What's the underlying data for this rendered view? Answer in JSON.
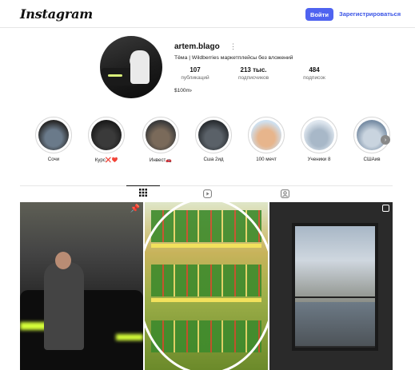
{
  "topbar": {
    "logo": "Instagram",
    "login_label": "Войти",
    "signup_label": "Зарегистрироваться",
    "accent_color": "#4f63f0"
  },
  "profile": {
    "username": "artem.blago",
    "bio": "Тёма | Wildberries маркетплейсы без вложений",
    "income": "$100m›",
    "stats": [
      {
        "value": "107",
        "label": "публикаций"
      },
      {
        "value": "213 тыс.",
        "label": "подписчиков"
      },
      {
        "value": "484",
        "label": "подписок"
      }
    ]
  },
  "highlights": [
    {
      "label": "Сочи",
      "colors": [
        "#2a2a2a",
        "#6a7a8a"
      ]
    },
    {
      "label": "Курс❌❤️",
      "colors": [
        "#1c1c1c",
        "#3a3a3a"
      ]
    },
    {
      "label": "Инвест🚗",
      "colors": [
        "#3b3b3b",
        "#7a6a5a"
      ]
    },
    {
      "label": "Сша 2ид",
      "colors": [
        "#2b2f33",
        "#5a6168"
      ]
    },
    {
      "label": "100 мечт",
      "colors": [
        "#cfe0ef",
        "#e7b58c"
      ]
    },
    {
      "label": "Ученики 8",
      "colors": [
        "#dfe7ef",
        "#a8b8c8"
      ]
    },
    {
      "label": "СШАив",
      "colors": [
        "#7a8fa6",
        "#c9d4df"
      ]
    }
  ],
  "tabs": {
    "active": "posts",
    "items": [
      "posts-grid-icon",
      "reels-icon",
      "tagged-icon"
    ]
  },
  "posts": [
    {
      "type": "pinned",
      "icon": "pin-icon"
    },
    {
      "type": "photo"
    },
    {
      "type": "carousel",
      "icon": "carousel-icon"
    }
  ]
}
